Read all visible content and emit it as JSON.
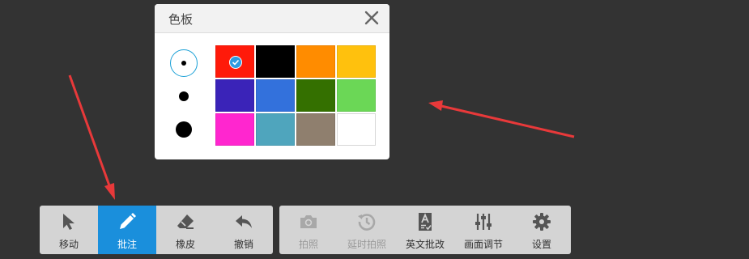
{
  "palette": {
    "title": "色板",
    "sizes": [
      "small",
      "medium",
      "large"
    ],
    "selected_size": "small",
    "colors": [
      "#ff1a0a",
      "#000000",
      "#ff8c00",
      "#ffc10d",
      "#3a23b8",
      "#3371dc",
      "#347000",
      "#6bd756",
      "#ff26cf",
      "#4fa5bd",
      "#8f7f6e",
      "#ffffff"
    ],
    "selected_color": "#ff1a0a"
  },
  "left_toolbar": {
    "items": [
      {
        "label": "移动",
        "icon": "cursor-arrow-icon",
        "state": "normal"
      },
      {
        "label": "批注",
        "icon": "pencil-icon",
        "state": "active"
      },
      {
        "label": "橡皮",
        "icon": "eraser-icon",
        "state": "normal"
      },
      {
        "label": "撤销",
        "icon": "undo-icon",
        "state": "normal"
      }
    ]
  },
  "right_toolbar": {
    "items": [
      {
        "label": "拍照",
        "icon": "camera-icon",
        "state": "disabled"
      },
      {
        "label": "延时拍照",
        "icon": "history-clock-icon",
        "state": "disabled"
      },
      {
        "label": "英文批改",
        "icon": "document-check-icon",
        "state": "normal"
      },
      {
        "label": "画面调节",
        "icon": "sliders-icon",
        "state": "normal"
      },
      {
        "label": "设置",
        "icon": "gear-icon",
        "state": "normal"
      }
    ]
  },
  "colors": {
    "background": "#333333",
    "accent": "#1a8fdc",
    "arrow": "#e8393a",
    "toolbar": "#d4d4d4"
  }
}
